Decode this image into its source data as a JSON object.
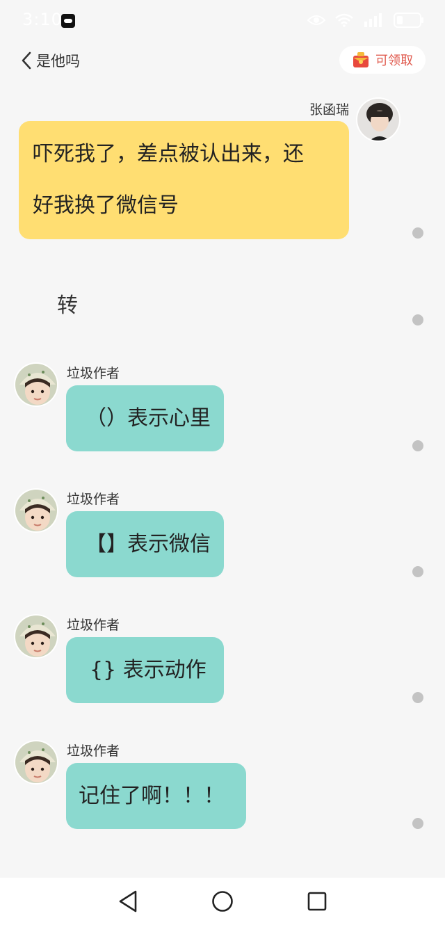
{
  "status_bar": {
    "time": "3:10",
    "icons": [
      "app-notification-icon",
      "eye-icon",
      "wifi-icon",
      "signal-icon",
      "battery-icon"
    ]
  },
  "header": {
    "title": "是他吗",
    "reward_label": "可领取"
  },
  "messages": [
    {
      "speaker": "张函瑞",
      "lines": [
        "吓死我了，差点被认出来，还",
        "好我换了微信号"
      ],
      "color": "#ffde72"
    },
    {
      "narration": "转"
    },
    {
      "speaker": "垃圾作者",
      "text": "（）表示心里",
      "color": "#8bd9cf"
    },
    {
      "speaker": "垃圾作者",
      "text": "【】表示微信",
      "color": "#8bd9cf"
    },
    {
      "speaker": "垃圾作者",
      "text": "{} 表示动作",
      "color": "#8bd9cf"
    },
    {
      "speaker": "垃圾作者",
      "text": "记住了啊！！！",
      "color": "#8bd9cf"
    }
  ],
  "nav": [
    "back-triangle-icon",
    "home-circle-icon",
    "recents-square-icon"
  ]
}
